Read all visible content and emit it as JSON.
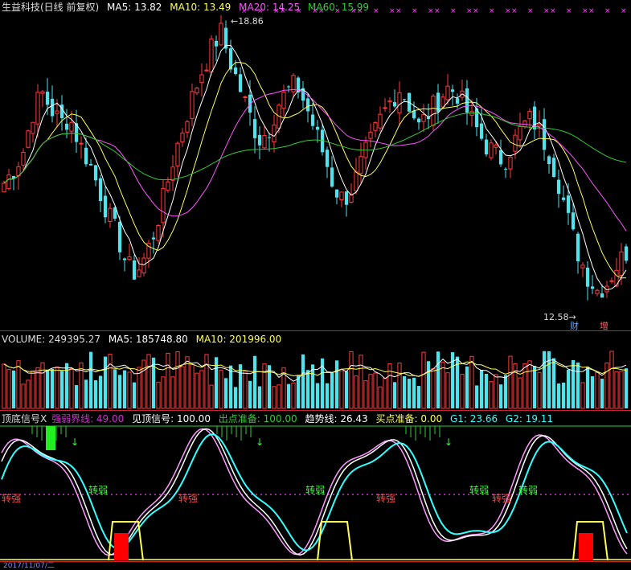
{
  "price_header": {
    "title": "生益科技(日线 前复权)",
    "ma5": "MA5: 13.82",
    "ma10": "MA10: 13.49",
    "ma20": "MA20: 14.25",
    "ma60": "MA60: 15.99"
  },
  "price_labels": {
    "high": "18.86",
    "low": "12.58",
    "tag_cai": "财",
    "tag_zeng": "增"
  },
  "volume_header": {
    "volume": "VOLUME: 249395.27",
    "ma5": "MA5: 185748.80",
    "ma10": "MA10: 201996.00"
  },
  "indicator_header": {
    "name": "顶底信号X",
    "strong_weak_line": "强弱界线: 49.00",
    "top_signal": "见顶信号: 100.00",
    "exit_ready": "出点准备: 100.00",
    "trend_line": "趋势线: 26.43",
    "buy_ready": "买点准备: 0.00",
    "g1": "G1: 23.66",
    "g2": "G2: 19.11"
  },
  "indicator_labels": {
    "strong": "转强",
    "weak": "转弱",
    "strong_labels": [
      "转强",
      "转强",
      "转强",
      "转强"
    ],
    "weak_labels": [
      "转弱",
      "转弱",
      "转弱",
      "转弱",
      "转弱"
    ]
  },
  "footer": {
    "date_text": "2017/11/07/二"
  },
  "colors": {
    "up": "#ff3b3b",
    "down": "#4de4f0",
    "ma5": "#ffffff",
    "ma10": "#ffff55",
    "ma20": "#ff55ff",
    "ma60": "#33cc33",
    "vol_ma5": "#ffffff",
    "vol_ma10": "#ffff55",
    "strong_weak": "#cc33cc",
    "top_signal": "#ffffff",
    "exit_ready": "#33cc33",
    "trend": "#ffffff",
    "buy_ready": "#ffff55",
    "g1": "#33ffff",
    "g2": "#33ffff"
  },
  "chart_data": {
    "type": "candlestick",
    "title": "生益科技(日线 前复权)",
    "price_labels": {
      "max_marked": 18.86,
      "min_marked": 12.58
    },
    "ylim": [
      12.0,
      19.2
    ],
    "price_path": [
      15.3,
      15.6,
      16.0,
      16.9,
      17.4,
      17.0,
      16.7,
      16.8,
      16.2,
      15.8,
      15.2,
      14.6,
      14.1,
      13.4,
      13.2,
      13.6,
      14.2,
      15.0,
      15.9,
      16.6,
      17.3,
      17.9,
      18.4,
      18.8,
      18.1,
      17.5,
      16.9,
      16.3,
      16.5,
      17.1,
      17.4,
      17.6,
      17.1,
      16.5,
      15.9,
      15.2,
      14.9,
      15.2,
      15.8,
      16.3,
      16.8,
      17.2,
      17.5,
      17.1,
      16.6,
      16.9,
      17.2,
      17.5,
      17.4,
      17.0,
      16.6,
      16.2,
      16.0,
      15.8,
      16.2,
      16.6,
      16.8,
      16.4,
      15.9,
      15.2,
      14.3,
      13.6,
      13.1,
      12.8,
      13.0,
      13.4,
      13.7
    ],
    "volume_ma": {
      "ma5": 185748.8,
      "ma10": 201996.0,
      "volume": 249395.27
    },
    "indicator": {
      "strong_weak_line": 49.0,
      "top_signal": 100.0,
      "exit_ready": 100.0,
      "trend_line": 26.43,
      "buy_ready": 0.0,
      "g1": 23.66,
      "g2": 19.11
    }
  }
}
